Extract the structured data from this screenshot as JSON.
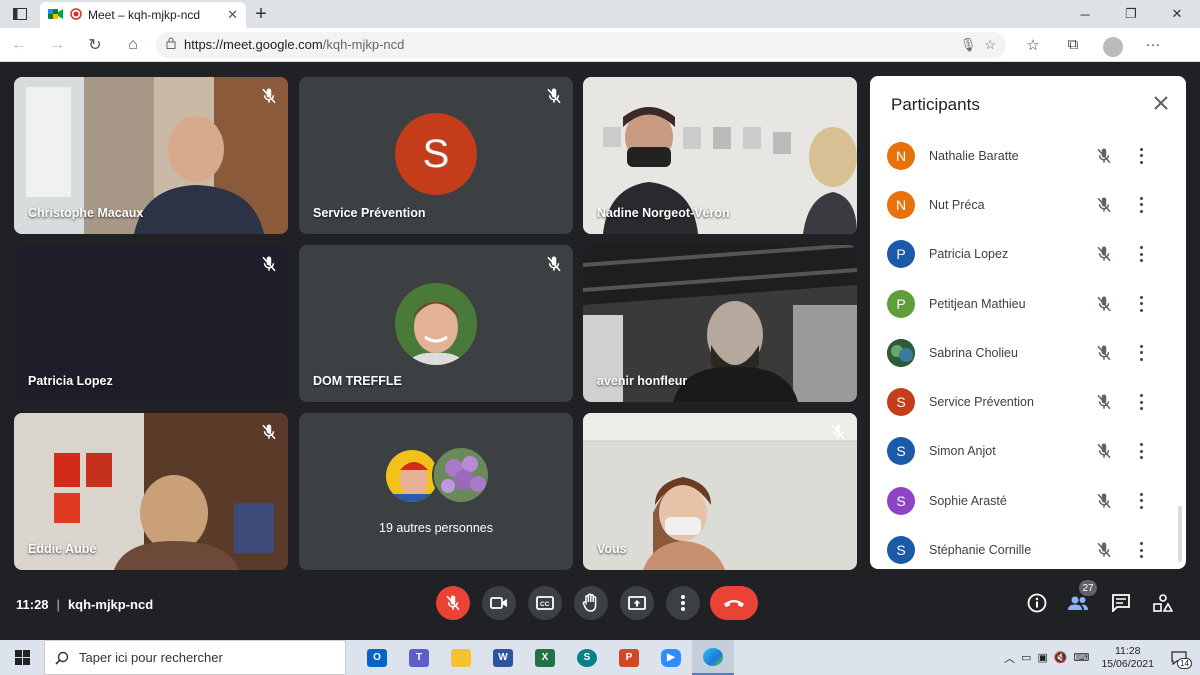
{
  "browser": {
    "tab_title": "Meet – kqh-mjkp-ncd",
    "url_domain": "https://meet.google.com",
    "url_path": "/kqh-mjkp-ncd"
  },
  "tiles": [
    {
      "name": "Christophe Macaux"
    },
    {
      "name": "Service Prévention",
      "avatar_letter": "S",
      "avatar_color": "#c53c1b"
    },
    {
      "name": "Nadine Norgeot-Véron"
    },
    {
      "name": "Patricia Lopez"
    },
    {
      "name": "DOM TREFFLE"
    },
    {
      "name": "avenir honfleur"
    },
    {
      "name": "Eddie Aubé"
    },
    {
      "name": "19 autres personnes"
    },
    {
      "name": "Vous"
    }
  ],
  "panel": {
    "title": "Participants",
    "participants": [
      {
        "letter": "N",
        "name": "Nathalie Baratte",
        "color": "#e8710a"
      },
      {
        "letter": "N",
        "name": "Nut Préca",
        "color": "#e8710a"
      },
      {
        "letter": "P",
        "name": "Patricia Lopez",
        "color": "#1a5aa8"
      },
      {
        "letter": "P",
        "name": "Petitjean Mathieu",
        "color": "#5f9e3b"
      },
      {
        "letter": "",
        "name": "Sabrina Cholieu",
        "color": "#2e5a3a"
      },
      {
        "letter": "S",
        "name": "Service Prévention",
        "color": "#c53c1b"
      },
      {
        "letter": "S",
        "name": "Simon Anjot",
        "color": "#1a5aa8"
      },
      {
        "letter": "S",
        "name": "Sophie Arasté",
        "color": "#8e44c4"
      },
      {
        "letter": "S",
        "name": "Stéphanie Cornille",
        "color": "#1a5aa8"
      }
    ]
  },
  "meeting": {
    "time": "11:28",
    "code": "kqh-mjkp-ncd",
    "participant_count": "27"
  },
  "taskbar": {
    "search_placeholder": "Taper ici pour rechercher",
    "time": "11:28",
    "date": "15/06/2021",
    "notifications": "14"
  }
}
